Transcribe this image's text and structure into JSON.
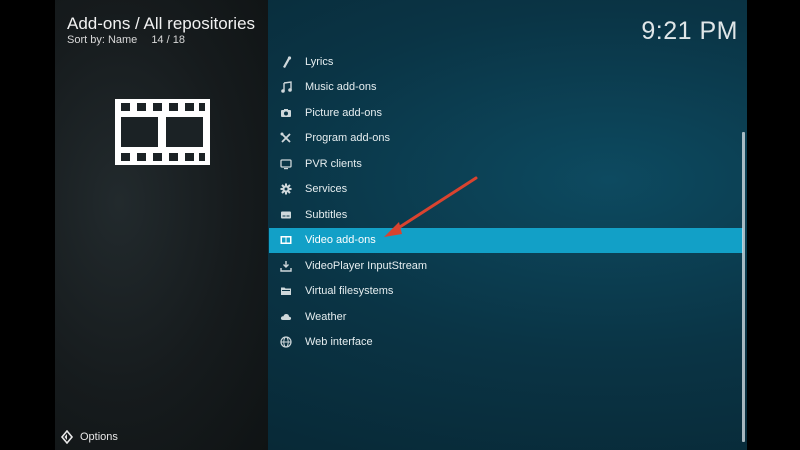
{
  "header": {
    "title": "Add-ons / All repositories",
    "sort_label": "Sort by: Name",
    "count": "14 / 18"
  },
  "clock": "9:21 PM",
  "hero_icon": "film-strip-icon",
  "list": {
    "items": [
      {
        "label": "Lyrics",
        "icon": "lyrics-icon"
      },
      {
        "label": "Music add-ons",
        "icon": "music-note-icon"
      },
      {
        "label": "Picture add-ons",
        "icon": "camera-icon"
      },
      {
        "label": "Program add-ons",
        "icon": "tools-icon"
      },
      {
        "label": "PVR clients",
        "icon": "tv-icon"
      },
      {
        "label": "Services",
        "icon": "gear-icon"
      },
      {
        "label": "Subtitles",
        "icon": "subtitles-icon"
      },
      {
        "label": "Video add-ons",
        "icon": "video-icon",
        "selected": true
      },
      {
        "label": "VideoPlayer InputStream",
        "icon": "download-icon"
      },
      {
        "label": "Virtual filesystems",
        "icon": "folder-icon"
      },
      {
        "label": "Weather",
        "icon": "cloud-icon"
      },
      {
        "label": "Web interface",
        "icon": "globe-icon"
      }
    ]
  },
  "footer": {
    "options_label": "Options"
  },
  "colors": {
    "selection": "#12a0c7",
    "annotation_arrow": "#d9432f"
  }
}
